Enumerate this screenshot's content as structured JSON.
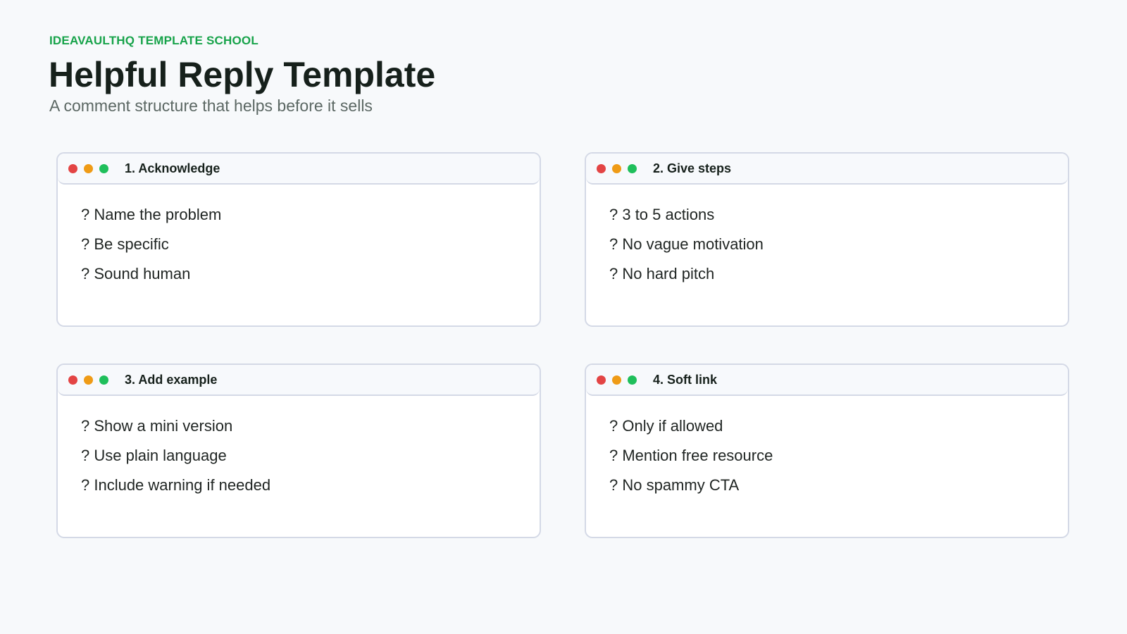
{
  "header": {
    "eyebrow": "IDEAVAULTHQ TEMPLATE SCHOOL",
    "title": "Helpful Reply Template",
    "subtitle": "A comment structure that helps before it sells"
  },
  "cards": [
    {
      "title": "1. Acknowledge",
      "items": [
        "? Name the problem",
        "? Be specific",
        "? Sound human"
      ]
    },
    {
      "title": "2. Give steps",
      "items": [
        "? 3 to 5 actions",
        "? No vague motivation",
        "? No hard pitch"
      ]
    },
    {
      "title": "3. Add example",
      "items": [
        "? Show a mini version",
        "? Use plain language",
        "? Include warning if needed"
      ]
    },
    {
      "title": "4. Soft link",
      "items": [
        "? Only if allowed",
        "? Mention free resource",
        "? No spammy CTA"
      ]
    }
  ],
  "colors": {
    "accent": "#17a34a",
    "dot_red": "#e34444",
    "dot_amber": "#ef9b16",
    "dot_green": "#1fbf5b"
  }
}
